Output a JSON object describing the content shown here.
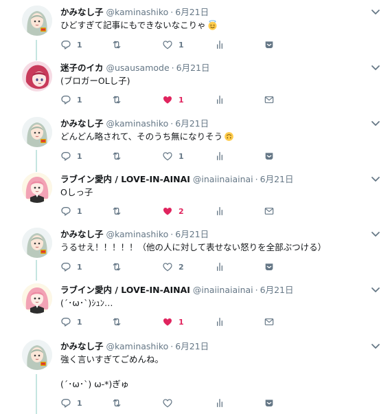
{
  "colors": {
    "accent_like": "#e0245e",
    "muted": "#657786",
    "thread_line": "#c4e5e0",
    "dm_fill": "#657786"
  },
  "tweets": [
    {
      "avatar": "kaminashiko-avatar",
      "name": "かみなし子",
      "handle": "@kaminashiko",
      "time": "6月21日",
      "text": "ひどすぎて記事にもできないなこりゃ",
      "emoji": "halo-smile-emoji",
      "reply_count": "1",
      "retweet_count": "",
      "like_count": "1",
      "liked": false,
      "last_action": "dm-icon"
    },
    {
      "avatar": "usausamode-avatar",
      "name": "迷子のイカ",
      "handle": "@usausamode",
      "time": "6月21日",
      "text": "(ブロガーOLし子)",
      "emoji": "",
      "reply_count": "1",
      "retweet_count": "",
      "like_count": "1",
      "liked": true,
      "last_action": "mail-icon"
    },
    {
      "avatar": "kaminashiko-avatar",
      "name": "かみなし子",
      "handle": "@kaminashiko",
      "time": "6月21日",
      "text": "どんどん略されて、そのうち無になりそう",
      "emoji": "upside-down-face-emoji",
      "reply_count": "1",
      "retweet_count": "",
      "like_count": "1",
      "liked": false,
      "last_action": "dm-icon"
    },
    {
      "avatar": "inaiinaiainai-avatar",
      "name": "ラブイン愛内 / LOVE-IN-AINAI",
      "handle": "@inaiinaiainai",
      "time": "6月21日",
      "text": "Oしっ子",
      "emoji": "",
      "reply_count": "1",
      "retweet_count": "",
      "like_count": "2",
      "liked": true,
      "last_action": "mail-icon"
    },
    {
      "avatar": "kaminashiko-avatar",
      "name": "かみなし子",
      "handle": "@kaminashiko",
      "time": "6月21日",
      "text": "うるせえ！！！！！（他の人に対して表せない怒りを全部ぶつける）",
      "emoji": "",
      "reply_count": "1",
      "retweet_count": "",
      "like_count": "2",
      "liked": false,
      "last_action": "dm-icon"
    },
    {
      "avatar": "inaiinaiainai-avatar",
      "name": "ラブイン愛内 / LOVE-IN-AINAI",
      "handle": "@inaiinaiainai",
      "time": "6月21日",
      "text": "(´･ω･`)ｼｭﾝ…",
      "emoji": "",
      "reply_count": "1",
      "retweet_count": "",
      "like_count": "1",
      "liked": true,
      "last_action": "mail-icon"
    },
    {
      "avatar": "kaminashiko-avatar",
      "name": "かみなし子",
      "handle": "@kaminashiko",
      "time": "6月21日",
      "text": "強く言いすぎてごめんね。\n\n(´･ω･`) ω-*)ぎゅ",
      "emoji": "",
      "reply_count": "1",
      "retweet_count": "",
      "like_count": "",
      "liked": false,
      "last_action": "dm-icon"
    }
  ]
}
